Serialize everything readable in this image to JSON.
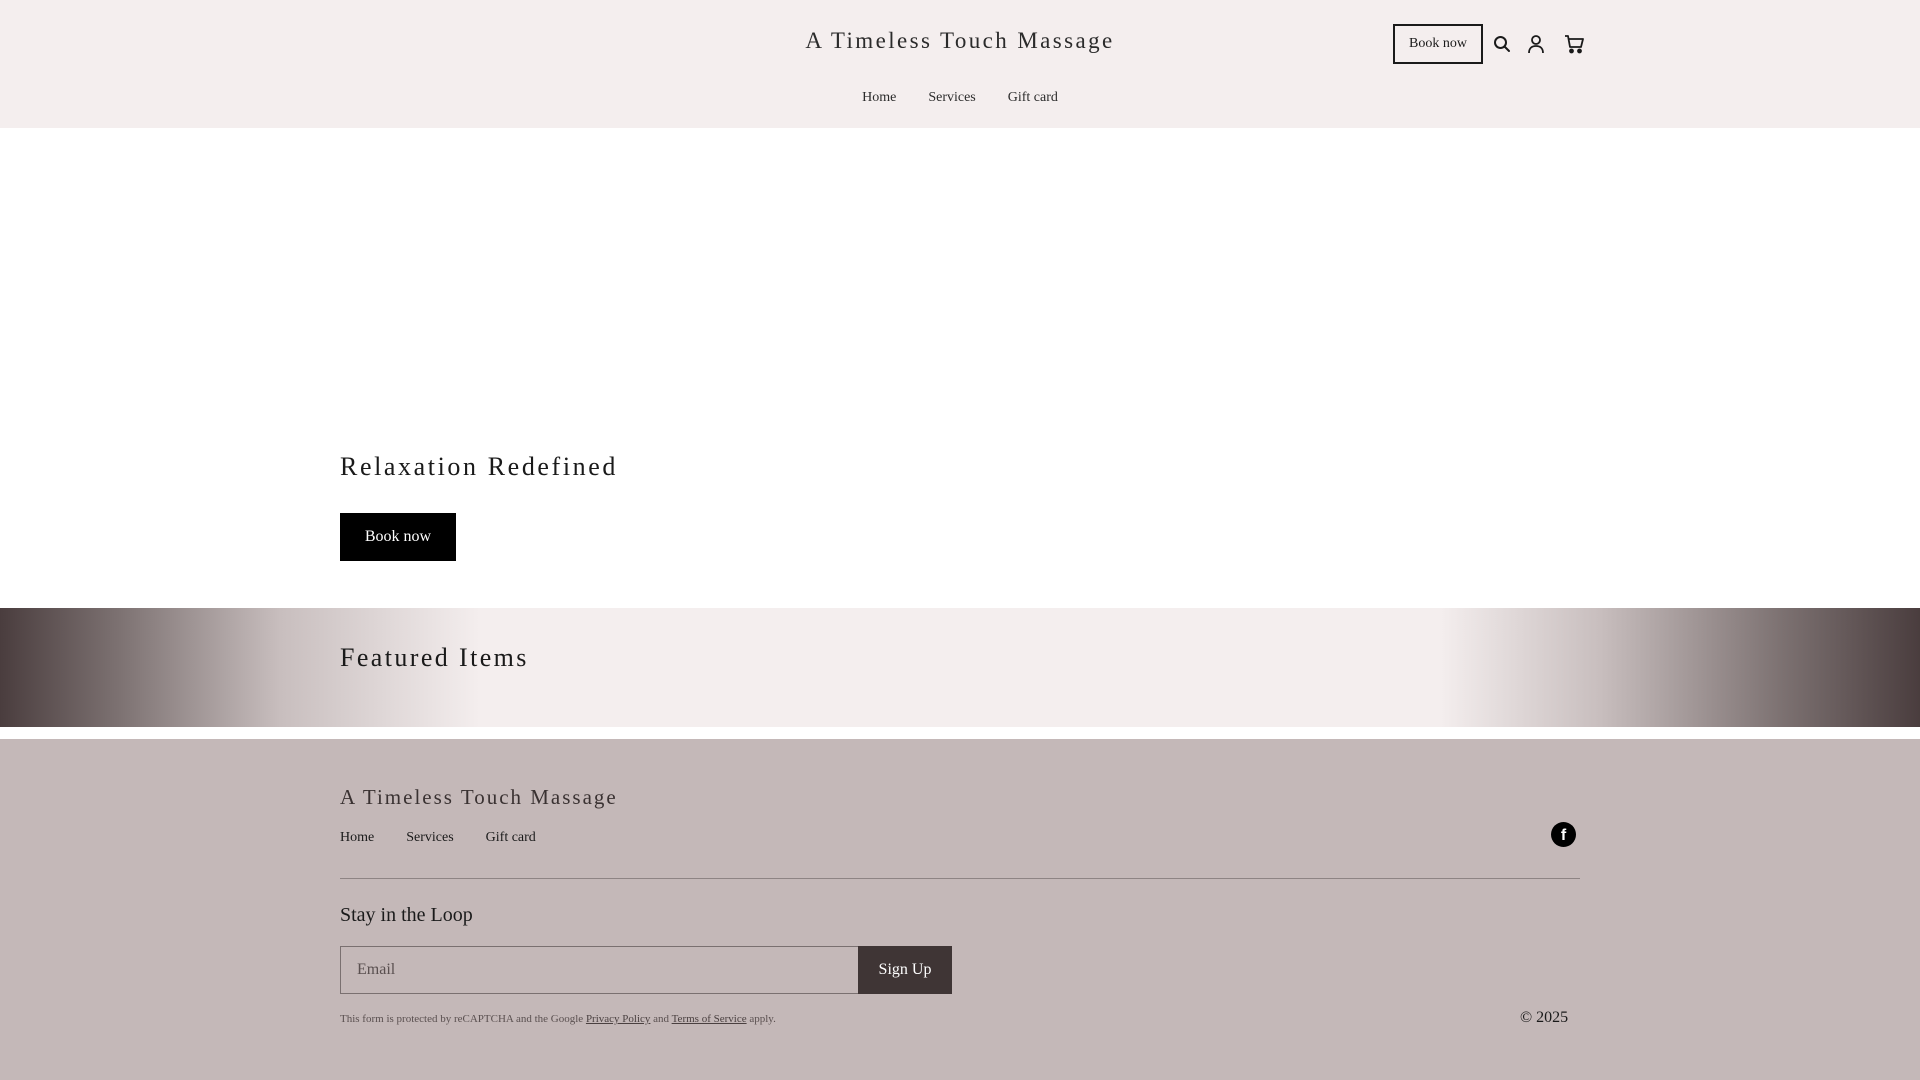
{
  "header": {
    "brand": "A Timeless Touch Massage",
    "book_label": "Book now",
    "icons": [
      "search-icon",
      "account-icon",
      "cart-icon"
    ],
    "nav": [
      "Home",
      "Services",
      "Gift card"
    ]
  },
  "hero": {
    "title": "Relaxation Redefined",
    "cta_label": "Book now"
  },
  "featured": {
    "title": "Featured Items"
  },
  "footer": {
    "brand": "A Timeless Touch Massage",
    "nav": [
      "Home",
      "Services",
      "Gift card"
    ],
    "social_icon": "facebook-icon",
    "newsletter_title": "Stay in the Loop",
    "email_placeholder": "Email",
    "signup_label": "Sign Up",
    "recaptcha": {
      "prefix": "This form is protected by reCAPTCHA and the Google",
      "privacy": "Privacy Policy",
      "and": "and",
      "terms": "Terms of Service",
      "suffix": "apply."
    },
    "copyright": "© 2025"
  },
  "colors": {
    "header_bg": "#f4eeee",
    "footer_bg": "#c4b8b8",
    "cta_bg": "#000000",
    "signup_bg": "#3f3535"
  }
}
